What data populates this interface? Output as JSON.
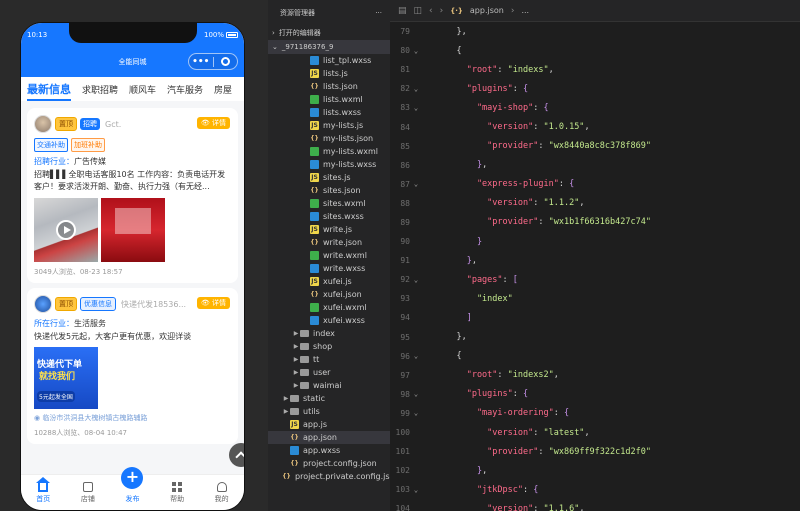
{
  "phone": {
    "time": "10:13",
    "battery": "100%",
    "nav_title": "全能同城",
    "capsule_dots": "•••",
    "tabs": [
      "最新信息",
      "求职招聘",
      "顺风车",
      "汽车服务",
      "房屋"
    ],
    "cards": [
      {
        "tag_top": "置顶",
        "tag_type": "招聘",
        "name_gray": "Gct.",
        "detail": "详情",
        "subtags": [
          "交通补助",
          "加班补助"
        ],
        "industry_key": "招聘行业：",
        "industry_val": "广告传媒",
        "desc": "招聘▌▌▌全职电话客服10名 工作内容：负责电话开发客户！要求活泼开朗、勤奋、执行力强（有无经...",
        "meta": "3049人浏览、08-23 18:57"
      },
      {
        "tag_top": "置顶",
        "tag_type": "优惠信息",
        "name_gray": "快递代发18536...",
        "detail": "详情",
        "industry_key": "所在行业：",
        "industry_val": "生活服务",
        "desc": "快递代发5元起，大客户更有优惠，欢迎详谈",
        "poster_l1": "快递代下单",
        "poster_l2": "就找我们",
        "poster_l3": "5元起发全国",
        "location": "临汾市洪洞县大槐树镇古槐路辅路",
        "meta": "10288人浏览、08-04 10:47"
      }
    ],
    "tabbar": [
      "首页",
      "店铺",
      "发布",
      "帮助",
      "我的"
    ]
  },
  "explorer": {
    "title": "资源管理器",
    "more": "···",
    "open_editors": "打开的编辑器",
    "project": "_971186376_9",
    "files": [
      {
        "name": "list_tpl.wxss",
        "type": "wxss",
        "indent": 2
      },
      {
        "name": "lists.js",
        "type": "js",
        "indent": 2
      },
      {
        "name": "lists.json",
        "type": "json",
        "indent": 2
      },
      {
        "name": "lists.wxml",
        "type": "wxml",
        "indent": 2
      },
      {
        "name": "lists.wxss",
        "type": "wxss",
        "indent": 2
      },
      {
        "name": "my-lists.js",
        "type": "js",
        "indent": 2
      },
      {
        "name": "my-lists.json",
        "type": "json",
        "indent": 2
      },
      {
        "name": "my-lists.wxml",
        "type": "wxml",
        "indent": 2
      },
      {
        "name": "my-lists.wxss",
        "type": "wxss",
        "indent": 2
      },
      {
        "name": "sites.js",
        "type": "js",
        "indent": 2
      },
      {
        "name": "sites.json",
        "type": "json",
        "indent": 2
      },
      {
        "name": "sites.wxml",
        "type": "wxml",
        "indent": 2
      },
      {
        "name": "sites.wxss",
        "type": "wxss",
        "indent": 2
      },
      {
        "name": "write.js",
        "type": "js",
        "indent": 2
      },
      {
        "name": "write.json",
        "type": "json",
        "indent": 2
      },
      {
        "name": "write.wxml",
        "type": "wxml",
        "indent": 2
      },
      {
        "name": "write.wxss",
        "type": "wxss",
        "indent": 2
      },
      {
        "name": "xufei.js",
        "type": "js",
        "indent": 2
      },
      {
        "name": "xufei.json",
        "type": "json",
        "indent": 2
      },
      {
        "name": "xufei.wxml",
        "type": "wxml",
        "indent": 2
      },
      {
        "name": "xufei.wxss",
        "type": "wxss",
        "indent": 2
      },
      {
        "name": "index",
        "type": "folder",
        "indent": 1
      },
      {
        "name": "shop",
        "type": "folder",
        "indent": 1
      },
      {
        "name": "tt",
        "type": "folder",
        "indent": 1
      },
      {
        "name": "user",
        "type": "folder",
        "indent": 1
      },
      {
        "name": "waimai",
        "type": "folder",
        "indent": 1
      },
      {
        "name": "static",
        "type": "folder",
        "indent": 0
      },
      {
        "name": "utils",
        "type": "folder",
        "indent": 0
      },
      {
        "name": "app.js",
        "type": "js",
        "indent": 0
      },
      {
        "name": "app.json",
        "type": "json",
        "indent": 0,
        "selected": true
      },
      {
        "name": "app.wxss",
        "type": "wxss",
        "indent": 0
      },
      {
        "name": "project.config.json",
        "type": "json",
        "indent": 0
      },
      {
        "name": "project.private.config.js...",
        "type": "json",
        "indent": 0
      }
    ]
  },
  "editor": {
    "breadcrumb": "app.json",
    "breadcrumb_sep": "›",
    "breadcrumb_more": "...",
    "lines": [
      {
        "n": "79",
        "tokens": [
          [
            "p",
            "    },"
          ]
        ]
      },
      {
        "n": "80",
        "fold": true,
        "tokens": [
          [
            "p",
            "    {"
          ]
        ]
      },
      {
        "n": "81",
        "tokens": [
          [
            "k",
            "      \"root\""
          ],
          [
            "p",
            ": "
          ],
          [
            "s",
            "\"indexs\""
          ],
          [
            "p",
            ","
          ]
        ]
      },
      {
        "n": "82",
        "fold": true,
        "tokens": [
          [
            "k",
            "      \"plugins\""
          ],
          [
            "p",
            ": "
          ],
          [
            "b",
            "{"
          ]
        ]
      },
      {
        "n": "83",
        "fold": true,
        "tokens": [
          [
            "k",
            "        \"mayi-shop\""
          ],
          [
            "p",
            ": "
          ],
          [
            "b",
            "{"
          ]
        ]
      },
      {
        "n": "84",
        "tokens": [
          [
            "k",
            "          \"version\""
          ],
          [
            "p",
            ": "
          ],
          [
            "s",
            "\"1.0.15\""
          ],
          [
            "p",
            ","
          ]
        ]
      },
      {
        "n": "85",
        "tokens": [
          [
            "k",
            "          \"provider\""
          ],
          [
            "p",
            ": "
          ],
          [
            "s",
            "\"wx8440a8c8c378f869\""
          ]
        ]
      },
      {
        "n": "86",
        "tokens": [
          [
            "b",
            "        }"
          ],
          [
            "p",
            ","
          ]
        ]
      },
      {
        "n": "87",
        "fold": true,
        "tokens": [
          [
            "k",
            "        \"express-plugin\""
          ],
          [
            "p",
            ": "
          ],
          [
            "b",
            "{"
          ]
        ]
      },
      {
        "n": "88",
        "tokens": [
          [
            "k",
            "          \"version\""
          ],
          [
            "p",
            ": "
          ],
          [
            "s",
            "\"1.1.2\""
          ],
          [
            "p",
            ","
          ]
        ]
      },
      {
        "n": "89",
        "tokens": [
          [
            "k",
            "          \"provider\""
          ],
          [
            "p",
            ": "
          ],
          [
            "s",
            "\"wx1b1f66316b427c74\""
          ]
        ]
      },
      {
        "n": "90",
        "tokens": [
          [
            "b",
            "        }"
          ]
        ]
      },
      {
        "n": "91",
        "tokens": [
          [
            "b",
            "      }"
          ],
          [
            "p",
            ","
          ]
        ]
      },
      {
        "n": "92",
        "fold": true,
        "tokens": [
          [
            "k",
            "      \"pages\""
          ],
          [
            "p",
            ": "
          ],
          [
            "b",
            "["
          ]
        ]
      },
      {
        "n": "93",
        "tokens": [
          [
            "s",
            "        \"index\""
          ]
        ]
      },
      {
        "n": "94",
        "tokens": [
          [
            "b",
            "      ]"
          ]
        ]
      },
      {
        "n": "95",
        "tokens": [
          [
            "p",
            "    },"
          ]
        ]
      },
      {
        "n": "96",
        "fold": true,
        "tokens": [
          [
            "p",
            "    {"
          ]
        ]
      },
      {
        "n": "97",
        "tokens": [
          [
            "k",
            "      \"root\""
          ],
          [
            "p",
            ": "
          ],
          [
            "s",
            "\"indexs2\""
          ],
          [
            "p",
            ","
          ]
        ]
      },
      {
        "n": "98",
        "fold": true,
        "tokens": [
          [
            "k",
            "      \"plugins\""
          ],
          [
            "p",
            ": "
          ],
          [
            "b",
            "{"
          ]
        ]
      },
      {
        "n": "99",
        "fold": true,
        "tokens": [
          [
            "k",
            "        \"mayi-ordering\""
          ],
          [
            "p",
            ": "
          ],
          [
            "b",
            "{"
          ]
        ]
      },
      {
        "n": "100",
        "tokens": [
          [
            "k",
            "          \"version\""
          ],
          [
            "p",
            ": "
          ],
          [
            "s",
            "\"latest\""
          ],
          [
            "p",
            ","
          ]
        ]
      },
      {
        "n": "101",
        "tokens": [
          [
            "k",
            "          \"provider\""
          ],
          [
            "p",
            ": "
          ],
          [
            "s",
            "\"wx869ff9f322c1d2f0\""
          ]
        ]
      },
      {
        "n": "102",
        "tokens": [
          [
            "b",
            "        }"
          ],
          [
            "p",
            ","
          ]
        ]
      },
      {
        "n": "103",
        "fold": true,
        "tokens": [
          [
            "k",
            "        \"jtkDpsc\""
          ],
          [
            "p",
            ": "
          ],
          [
            "b",
            "{"
          ]
        ]
      },
      {
        "n": "104",
        "tokens": [
          [
            "k",
            "          \"version\""
          ],
          [
            "p",
            ": "
          ],
          [
            "s",
            "\"1.1.6\""
          ],
          [
            "p",
            ","
          ]
        ]
      }
    ]
  }
}
